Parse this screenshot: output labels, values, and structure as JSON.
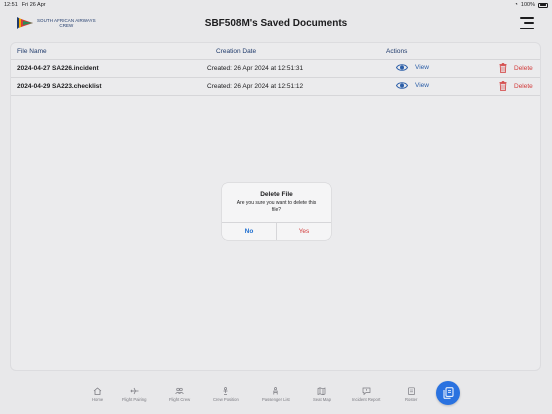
{
  "status_bar": {
    "time": "12:51",
    "date": "Fri 26 Apr",
    "battery": "100%"
  },
  "header": {
    "logo_line1": "SOUTH AFRICAN AIRWAYS",
    "logo_line2": "CREW",
    "title": "SBF508M's Saved Documents"
  },
  "table": {
    "columns": {
      "file_name": "File Name",
      "creation_date": "Creation Date",
      "actions": "Actions"
    },
    "rows": [
      {
        "file_name": "2024-04-27 SA226.incident",
        "created": "Created: 26 Apr 2024 at 12:51:31",
        "view": "View",
        "delete": "Delete"
      },
      {
        "file_name": "2024-04-29 SA223.checklist",
        "created": "Created: 26 Apr 2024 at 12:51:12",
        "view": "View",
        "delete": "Delete"
      }
    ]
  },
  "dialog": {
    "title": "Delete File",
    "message": "Are you sure you want to delete this file?",
    "no": "No",
    "yes": "Yes"
  },
  "tabs": [
    {
      "label": "Home",
      "icon": "home-icon"
    },
    {
      "label": "Flight Pairing",
      "icon": "airplane-icon"
    },
    {
      "label": "Flight Crew",
      "icon": "people-icon"
    },
    {
      "label": "Crew Position",
      "icon": "person-position-icon"
    },
    {
      "label": "Passenger List",
      "icon": "passenger-icon"
    },
    {
      "label": "Seat Map",
      "icon": "map-icon"
    },
    {
      "label": "Incident Report",
      "icon": "report-icon"
    },
    {
      "label": "Roster",
      "icon": "roster-icon"
    }
  ],
  "colors": {
    "accent_blue": "#2b5ea8",
    "delete_red": "#d23b3b",
    "fab_blue": "#2a72e0"
  }
}
